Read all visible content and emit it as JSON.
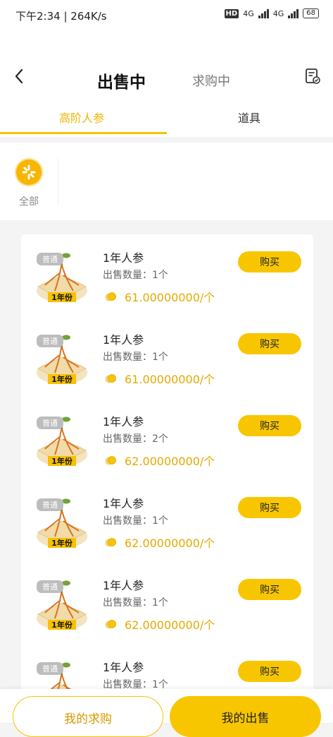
{
  "status_bar": {
    "time": "下午2:34 | 264K/s",
    "hd": "HD",
    "network1": "4G",
    "network2": "4G",
    "battery": "68"
  },
  "header": {
    "tab_active": "出售中",
    "tab_inactive": "求购中"
  },
  "subtabs": [
    "高阶人参",
    "道具"
  ],
  "category": {
    "label": "全部"
  },
  "buy_label": "购买",
  "items": [
    {
      "badge": "普通",
      "year": "1年份",
      "name": "1年人参",
      "qty": "出售数量：1个",
      "price": "61.00000000/个"
    },
    {
      "badge": "普通",
      "year": "1年份",
      "name": "1年人参",
      "qty": "出售数量：1个",
      "price": "61.00000000/个"
    },
    {
      "badge": "普通",
      "year": "1年份",
      "name": "1年人参",
      "qty": "出售数量：2个",
      "price": "62.00000000/个"
    },
    {
      "badge": "普通",
      "year": "1年份",
      "name": "1年人参",
      "qty": "出售数量：1个",
      "price": "62.00000000/个"
    },
    {
      "badge": "普通",
      "year": "1年份",
      "name": "1年人参",
      "qty": "出售数量：1个",
      "price": "62.00000000/个"
    },
    {
      "badge": "普通",
      "year": "1年份",
      "name": "1年人参",
      "qty": "出售数量：1个",
      "price": ""
    }
  ],
  "bottom": {
    "my_requests": "我的求购",
    "my_sales": "我的出售"
  },
  "colors": {
    "accent": "#f8c600",
    "price": "#e6a800",
    "active_tab": "#f2b400"
  }
}
